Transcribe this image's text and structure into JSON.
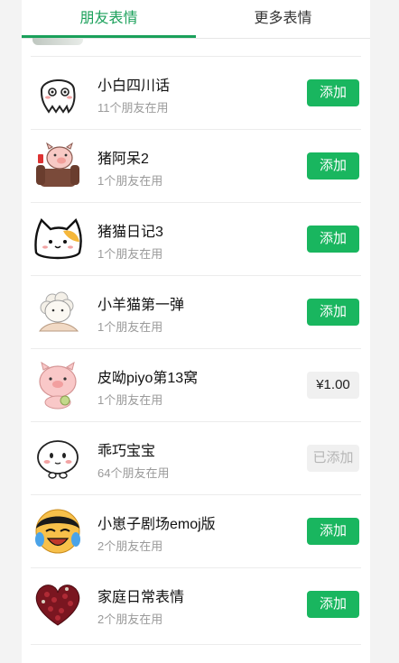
{
  "tabs": [
    {
      "label": "朋友表情",
      "active": true
    },
    {
      "label": "更多表情",
      "active": false
    }
  ],
  "colors": {
    "accent": "#1aa05a",
    "button_green": "#19b65f"
  },
  "items": [
    {
      "name": "小白四川话",
      "sub": "11个朋友在用",
      "action": "添加",
      "action_type": "add",
      "icon": "white-blob-sticker-icon"
    },
    {
      "name": "猪阿呆2",
      "sub": "1个朋友在用",
      "action": "添加",
      "action_type": "add",
      "icon": "pig-on-sofa-sticker-icon"
    },
    {
      "name": "猪猫日记3",
      "sub": "1个朋友在用",
      "action": "添加",
      "action_type": "add",
      "icon": "cat-face-sticker-icon"
    },
    {
      "name": "小羊猫第一弹",
      "sub": "1个朋友在用",
      "action": "添加",
      "action_type": "add",
      "icon": "sheep-cat-sticker-icon"
    },
    {
      "name": "皮呦piyo第13窝",
      "sub": "1个朋友在用",
      "action": "¥1.00",
      "action_type": "price",
      "icon": "pink-pig-sticker-icon"
    },
    {
      "name": "乖巧宝宝",
      "sub": "64个朋友在用",
      "action": "已添加",
      "action_type": "added",
      "icon": "white-baby-sticker-icon"
    },
    {
      "name": "小崽子剧场emoj版",
      "sub": "2个朋友在用",
      "action": "添加",
      "action_type": "add",
      "icon": "laughing-tears-sticker-icon"
    },
    {
      "name": "家庭日常表情",
      "sub": "2个朋友在用",
      "action": "添加",
      "action_type": "add",
      "icon": "heart-roses-sticker-icon"
    }
  ]
}
